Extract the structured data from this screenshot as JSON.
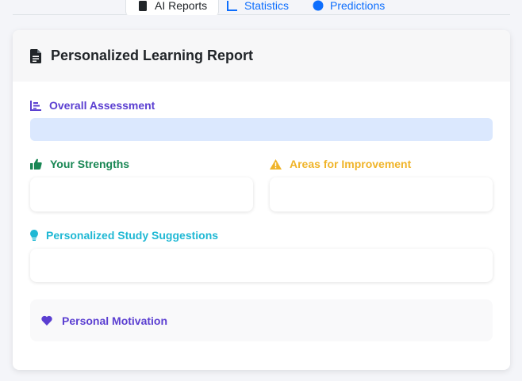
{
  "tabs": [
    {
      "label": "AI Reports",
      "icon": "clipboard-icon",
      "active": true
    },
    {
      "label": "Statistics",
      "icon": "chart-icon",
      "active": false
    },
    {
      "label": "Predictions",
      "icon": "pie-chart-icon",
      "active": false
    }
  ],
  "report": {
    "title": "Personalized Learning Report",
    "title_icon": "document-icon",
    "sections": {
      "overall": {
        "label": "Overall Assessment",
        "icon": "bar-chart-icon",
        "color": "#5b3fd1"
      },
      "strengths": {
        "label": "Your Strengths",
        "icon": "thumbs-up-icon",
        "color": "#198754"
      },
      "improvement": {
        "label": "Areas for Improvement",
        "icon": "warning-icon",
        "color": "#f0b429"
      },
      "suggestions": {
        "label": "Personalized Study Suggestions",
        "icon": "lightbulb-icon",
        "color": "#1fb8d4"
      },
      "motivation": {
        "label": "Personal Motivation",
        "icon": "heart-icon",
        "color": "#5b3fd1"
      }
    }
  },
  "colors": {
    "page_bg": "#f4f5f9",
    "overall_box": "#dbe8fe",
    "link": "#0d6efd"
  }
}
